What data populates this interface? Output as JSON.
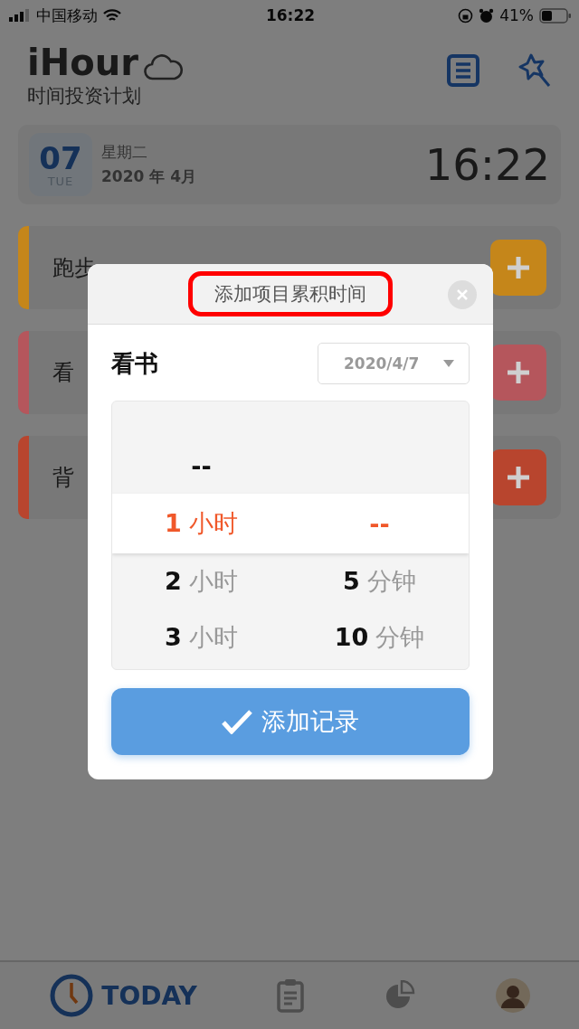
{
  "status_bar": {
    "carrier": "中国移动",
    "time": "16:22",
    "battery": "41%"
  },
  "header": {
    "logo": "iHour",
    "subtitle": "时间投资计划"
  },
  "date_card": {
    "day": "07",
    "weekday_short": "TUE",
    "weekday": "星期二",
    "month": "2020 年 4月",
    "clock": "16:22"
  },
  "tasks": [
    {
      "name": "跑步",
      "color": "#c5861a"
    },
    {
      "name": "看",
      "color": "#b5565c"
    },
    {
      "name": "背",
      "color": "#b8452e"
    }
  ],
  "dialog": {
    "title": "添加项目累积时间",
    "title_highlighted": true,
    "item": "看书",
    "date": "2020/4/7",
    "picker_rows": [
      {
        "selected": false,
        "hour": {
          "number": "--"
        }
      },
      {
        "selected": true,
        "hour": {
          "number": "1",
          "unit": "小时"
        },
        "minute": {
          "number": "--"
        }
      },
      {
        "selected": false,
        "hour": {
          "number": "2",
          "unit": "小时"
        },
        "minute": {
          "number": "5",
          "unit": "分钟"
        }
      },
      {
        "selected": false,
        "hour": {
          "number": "3",
          "unit": "小时"
        },
        "minute": {
          "number": "10",
          "unit": "分钟"
        }
      }
    ],
    "button": "添加记录"
  },
  "tabs": [
    {
      "kind": "today",
      "label": "TODAY",
      "selected": true
    },
    {
      "kind": "clipboard",
      "selected": false
    },
    {
      "kind": "chart",
      "selected": false
    },
    {
      "kind": "avatar",
      "selected": false
    }
  ]
}
